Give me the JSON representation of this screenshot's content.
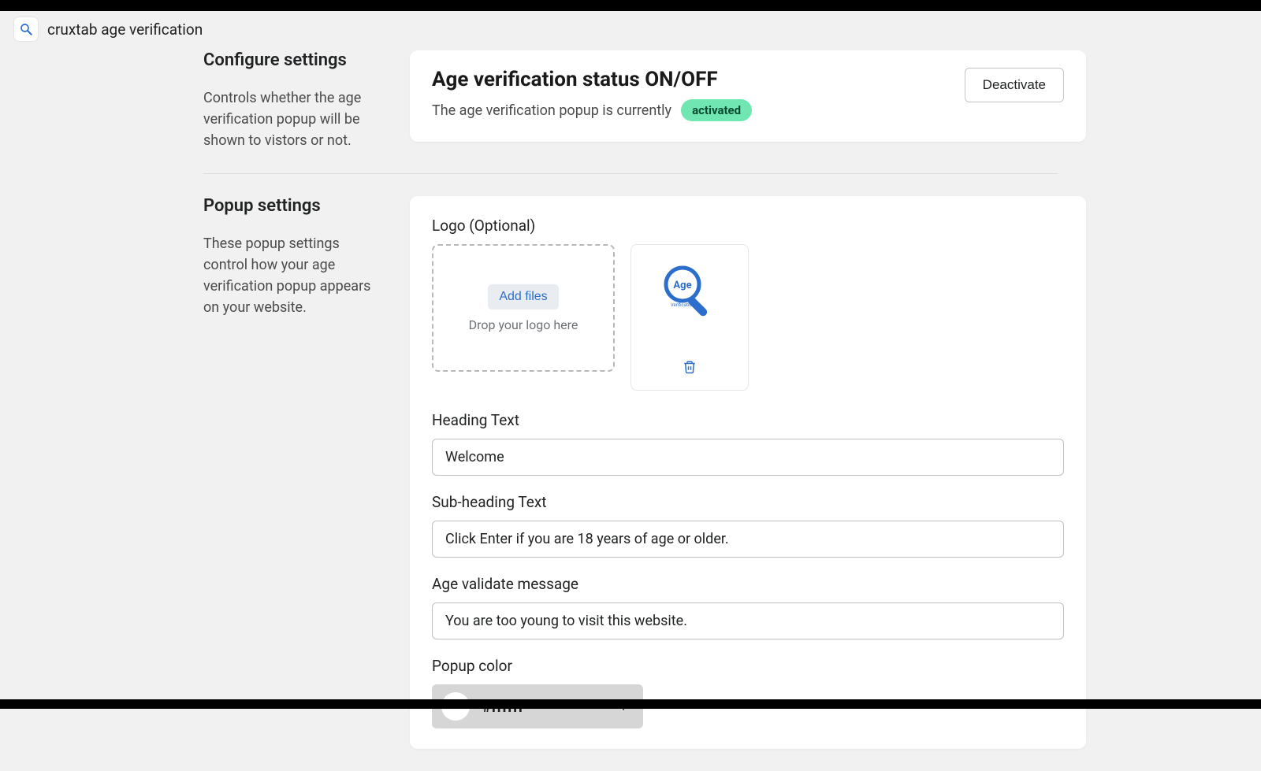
{
  "header": {
    "title": "cruxtab age verification"
  },
  "configure": {
    "title": "Configure settings",
    "desc": "Controls whether the age verification popup will be shown to vistors or not."
  },
  "status": {
    "title": "Age verification status ON/OFF",
    "desc_prefix": "The age verification popup is currently",
    "badge": "activated",
    "button": "Deactivate"
  },
  "popup": {
    "title": "Popup settings",
    "desc": "These popup settings control how your age verification popup appears on your website.",
    "logo_label": "Logo (Optional)",
    "add_files": "Add files",
    "drop_hint": "Drop your logo here",
    "heading_label": "Heading Text",
    "heading_value": "Welcome",
    "subheading_label": "Sub-heading Text",
    "subheading_value": "Click Enter if you are 18 years of age or older.",
    "validate_label": "Age validate message",
    "validate_value": "You are too young to visit this website.",
    "color_label": "Popup color",
    "color_value": "#ffffff"
  }
}
